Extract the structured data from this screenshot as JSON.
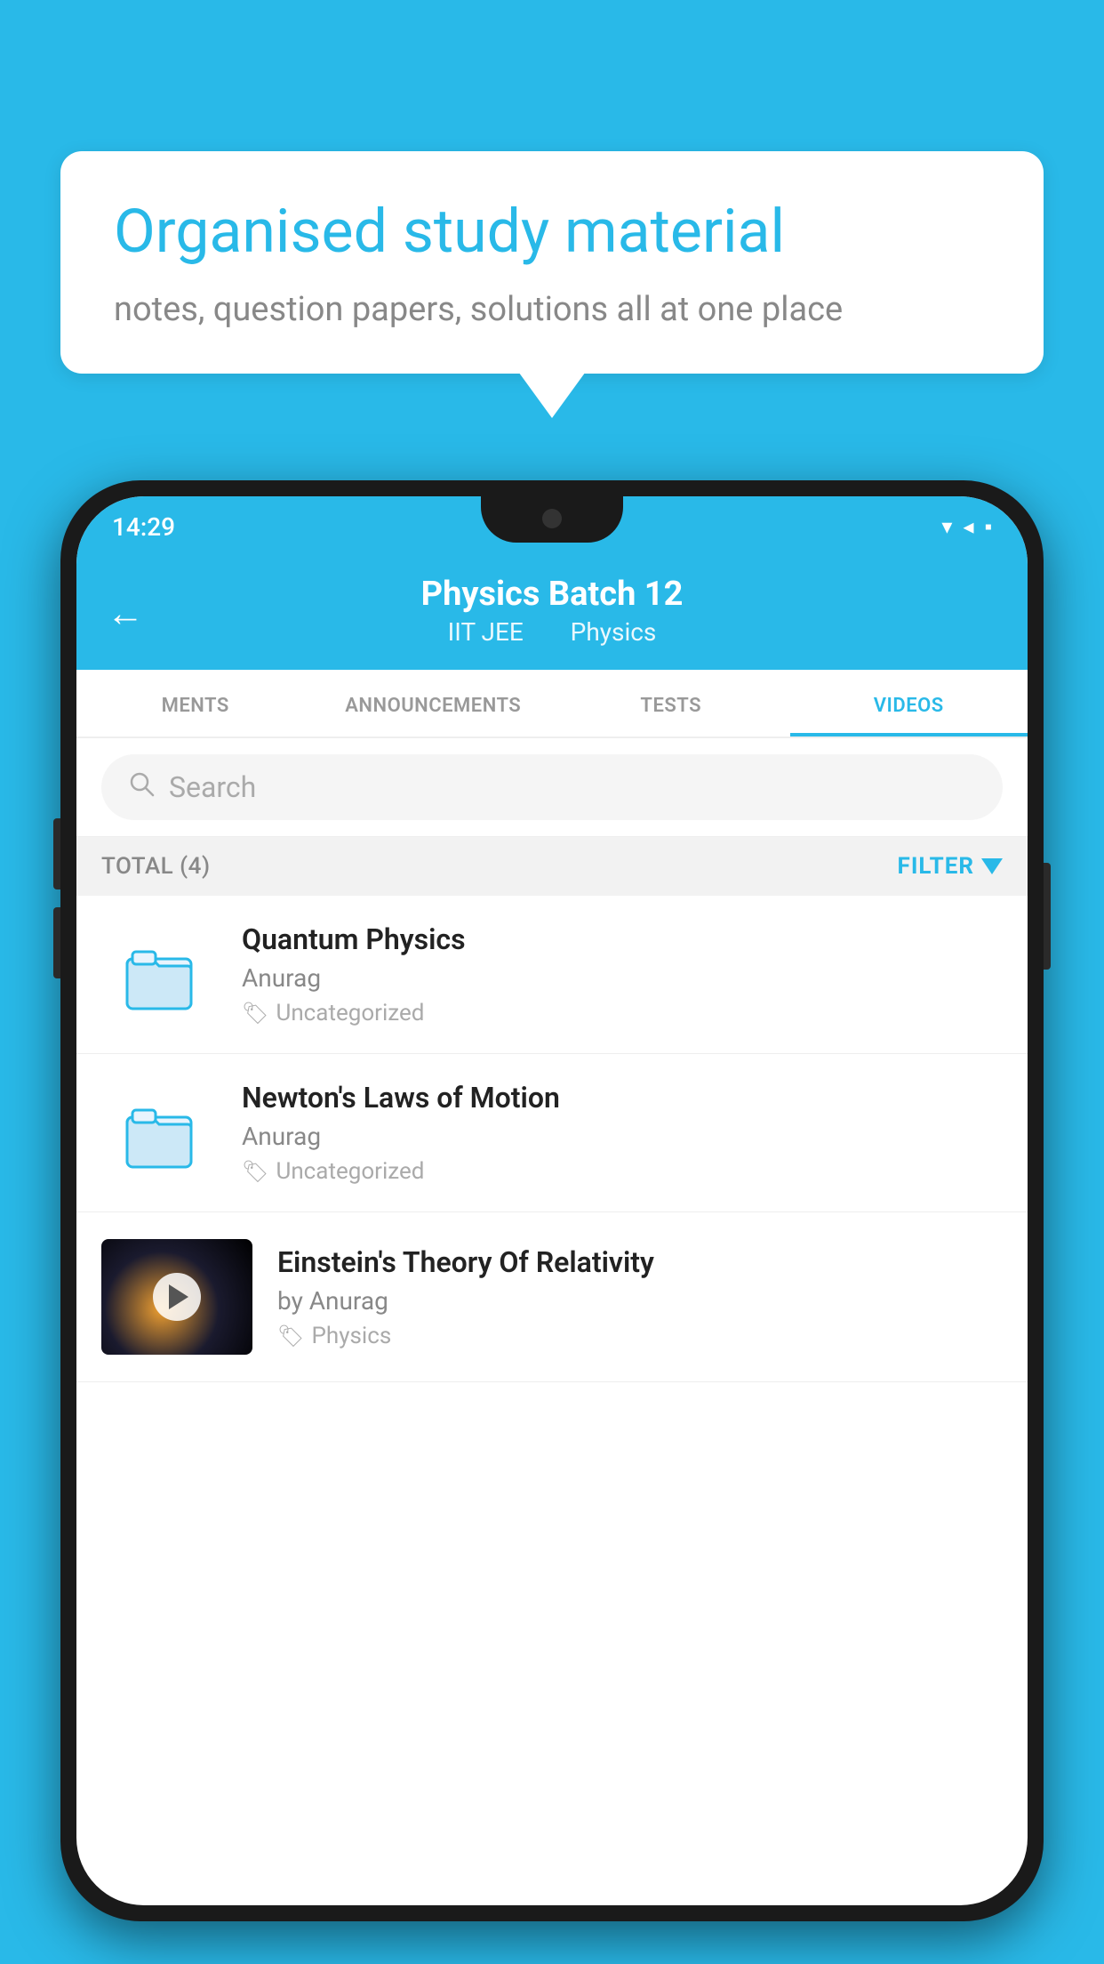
{
  "background": "#29B9E8",
  "bubble": {
    "title": "Organised study material",
    "subtitle": "notes, question papers, solutions all at one place"
  },
  "phone": {
    "status_bar": {
      "time": "14:29",
      "icons": "▾◂▪"
    },
    "header": {
      "back_label": "←",
      "title": "Physics Batch 12",
      "subtitle_part1": "IIT JEE",
      "subtitle_part2": "Physics"
    },
    "tabs": [
      {
        "label": "MENTS",
        "active": false
      },
      {
        "label": "ANNOUNCEMENTS",
        "active": false
      },
      {
        "label": "TESTS",
        "active": false
      },
      {
        "label": "VIDEOS",
        "active": true
      }
    ],
    "search": {
      "placeholder": "Search"
    },
    "filter": {
      "total_label": "TOTAL (4)",
      "filter_label": "FILTER"
    },
    "videos": [
      {
        "id": 1,
        "title": "Quantum Physics",
        "author": "Anurag",
        "tag": "Uncategorized",
        "has_thumb": false
      },
      {
        "id": 2,
        "title": "Newton's Laws of Motion",
        "author": "Anurag",
        "tag": "Uncategorized",
        "has_thumb": false
      },
      {
        "id": 3,
        "title": "Einstein's Theory Of Relativity",
        "author": "by Anurag",
        "tag": "Physics",
        "has_thumb": true
      }
    ]
  }
}
